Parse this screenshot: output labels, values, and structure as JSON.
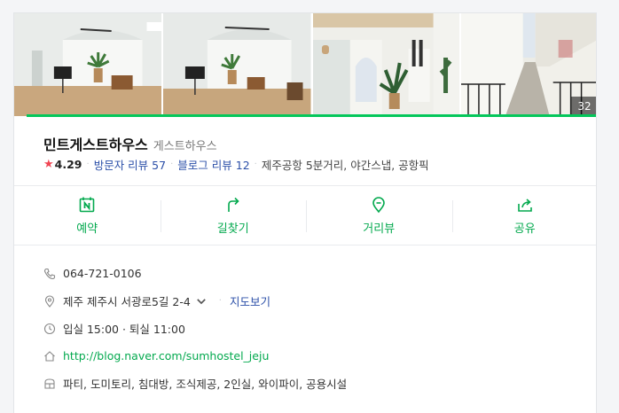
{
  "photos": {
    "count": "32",
    "items": [
      {
        "alt": "living-room-photo"
      },
      {
        "alt": "living-room-photo-2"
      },
      {
        "alt": "hallway-photo"
      },
      {
        "alt": "alley-photo"
      }
    ]
  },
  "place": {
    "name": "민트게스트하우스",
    "category": "게스트하우스",
    "rating": "4.29",
    "visitor_review_label": "방문자 리뷰",
    "visitor_review_count": "57",
    "blog_review_label": "블로그 리뷰",
    "blog_review_count": "12",
    "description": "제주공항 5분거리, 야간스냅, 공항픽"
  },
  "actions": [
    {
      "label": "예약",
      "icon": "calendar-icon"
    },
    {
      "label": "길찾기",
      "icon": "directions-icon"
    },
    {
      "label": "거리뷰",
      "icon": "street-view-icon"
    },
    {
      "label": "공유",
      "icon": "share-icon"
    }
  ],
  "details": {
    "phone": "064-721-0106",
    "address": "제주 제주시 서광로5길 2-4",
    "map_link": "지도보기",
    "hours": "입실 15:00 · 퇴실 11:00",
    "homepage": "http://blog.naver.com/sumhostel_jeju",
    "amenities": "파티, 도미토리, 침대방, 조식제공, 2인실, 와이파이, 공용시설"
  },
  "colors": {
    "accent_green": "#03c75a",
    "link_blue": "#2b4fa8",
    "star_red": "#f04452"
  }
}
